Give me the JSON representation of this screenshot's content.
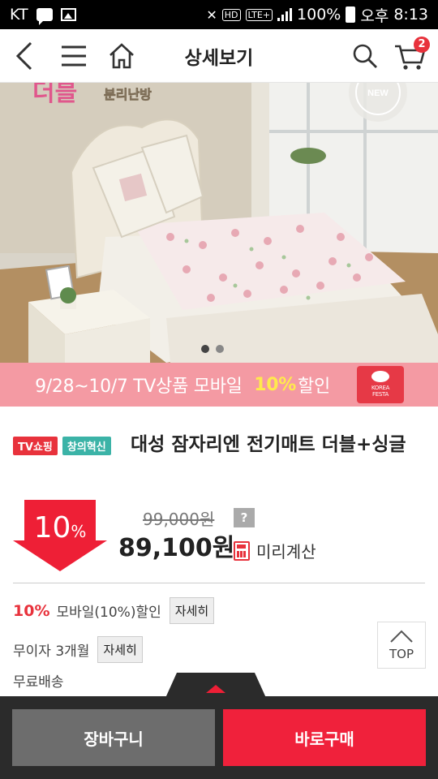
{
  "status_bar": {
    "carrier": "KT",
    "hd": "HD",
    "lte": "LTE+",
    "battery": "100%",
    "ampm": "오후",
    "time": "8:13"
  },
  "header": {
    "title": "상세보기",
    "cart_count": "2"
  },
  "hero": {
    "brand_text": "더블",
    "sub_text": "분리난방",
    "badge": "NEW",
    "slides": 2,
    "active_slide": 1
  },
  "promo": {
    "text_before": "9/28~10/7 TV상품 모바일 ",
    "highlight": "10%",
    "text_after": "할인",
    "festa_line1": "KOREA",
    "festa_line2": "FESTA"
  },
  "product": {
    "tags": [
      "TV쇼핑",
      "창의혁신"
    ],
    "title": "대성 잠자리엔 전기매트 더블+싱글",
    "discount_num": "10",
    "discount_unit": "%",
    "original_price": "99,000원",
    "help": "?",
    "price": "89,100원",
    "calc_label": "미리계산"
  },
  "benefits": {
    "mobile_pct": "10%",
    "mobile_text": "모바일(10%)할인",
    "installment": "무이자 3개월",
    "detail_label": "자세히",
    "shipping": "무료배송"
  },
  "top_button": "TOP",
  "actions": {
    "cart": "장바구니",
    "buy": "바로구매"
  },
  "colors": {
    "accent": "#f0213b",
    "promo_bg": "#f49aa3",
    "promo_highlight": "#ffe94d",
    "inno_tag": "#3bb3a7"
  }
}
